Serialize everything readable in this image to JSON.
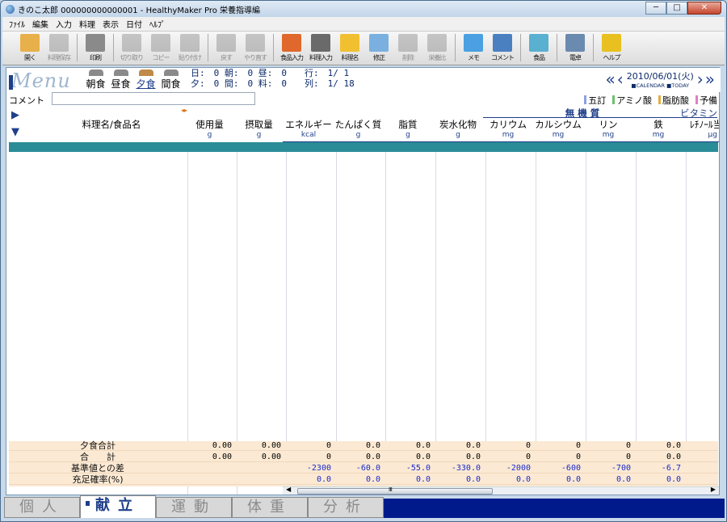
{
  "window": {
    "title": "きのこ太郎 000000000000001 - HealthyMaker Pro 栄養指導編",
    "min": "─",
    "max": "□",
    "close": "✕"
  },
  "menubar": [
    "ﾌｧｲﾙ",
    "編集",
    "入力",
    "料理",
    "表示",
    "日付",
    "ﾍﾙﾌﾟ"
  ],
  "toolbar": [
    {
      "label": "開く",
      "icon": "folder-icon",
      "disabled": false,
      "color": "#e8b04a"
    },
    {
      "label": "料理保存",
      "icon": "save-icon",
      "disabled": true,
      "color": "#8a8a8a"
    },
    {
      "label": "印刷",
      "icon": "printer-icon",
      "disabled": false,
      "color": "#8a8a8a"
    },
    {
      "label": "切り取り",
      "icon": "scissors-icon",
      "disabled": true,
      "color": "#8a8a8a"
    },
    {
      "label": "コピー",
      "icon": "copy-icon",
      "disabled": true,
      "color": "#8a8a8a"
    },
    {
      "label": "貼り付け",
      "icon": "paste-icon",
      "disabled": true,
      "color": "#8a8a8a"
    },
    {
      "label": "戻す",
      "icon": "undo-icon",
      "disabled": true,
      "color": "#8a8a8a"
    },
    {
      "label": "やり直す",
      "icon": "redo-icon",
      "disabled": true,
      "color": "#8a8a8a"
    },
    {
      "label": "食品入力",
      "icon": "vegetable-icon",
      "disabled": false,
      "color": "#e0682c"
    },
    {
      "label": "料理入力",
      "icon": "cutlery-icon",
      "disabled": false,
      "color": "#6a6a6a"
    },
    {
      "label": "料理名",
      "icon": "cook-icon",
      "disabled": false,
      "color": "#f0c030"
    },
    {
      "label": "修正",
      "icon": "eraser-icon",
      "disabled": false,
      "color": "#7ab0e0"
    },
    {
      "label": "削除",
      "icon": "trash-icon",
      "disabled": true,
      "color": "#8a8a8a"
    },
    {
      "label": "栄養比",
      "icon": "scale-icon",
      "disabled": true,
      "color": "#8a8a8a"
    },
    {
      "label": "メモ",
      "icon": "memo-icon",
      "disabled": false,
      "color": "#4aa0e0"
    },
    {
      "label": "コメント",
      "icon": "comment-icon",
      "disabled": false,
      "color": "#4a80c0"
    },
    {
      "label": "食品",
      "icon": "food-icon",
      "disabled": false,
      "color": "#5ab0d0"
    },
    {
      "label": "電卓",
      "icon": "calculator-icon",
      "disabled": false,
      "color": "#6a8ab0"
    },
    {
      "label": "ヘルプ",
      "icon": "help-icon",
      "disabled": false,
      "color": "#e8c020"
    }
  ],
  "header": {
    "logo": "Menu",
    "meals": [
      {
        "label": "朝食",
        "selected": false
      },
      {
        "label": "昼食",
        "selected": false
      },
      {
        "label": "夕食",
        "selected": true
      },
      {
        "label": "間食",
        "selected": false
      }
    ],
    "counts_line1": "日:　0 朝:　0 昼:　0　　行:　1/ 1",
    "counts_line2": "夕:　0 間:　0 料:　0　　列:　1/ 18",
    "date": "2010/06/01(火)",
    "calendar": "CALENDAR",
    "today": "TODAY"
  },
  "comment": {
    "label": "コメント",
    "value": ""
  },
  "tags": [
    {
      "label": "五訂",
      "color": "#8aa0e0"
    },
    {
      "label": "アミノ酸",
      "color": "#70c070"
    },
    {
      "label": "脂肪酸",
      "color": "#e0b040"
    },
    {
      "label": "予備",
      "color": "#e080c0"
    }
  ],
  "columns": {
    "name": "料理名/食品名",
    "group_minerals": "無 機 質",
    "group_vitamins": "ビタミン",
    "cols": [
      {
        "label": "使用量",
        "unit": "g"
      },
      {
        "label": "摂取量",
        "unit": "g"
      },
      {
        "label": "エネルギー",
        "unit": "kcal"
      },
      {
        "label": "たんぱく質",
        "unit": "g"
      },
      {
        "label": "脂質",
        "unit": "g"
      },
      {
        "label": "炭水化物",
        "unit": "g"
      },
      {
        "label": "カリウム",
        "unit": "mg"
      },
      {
        "label": "カルシウム",
        "unit": "mg"
      },
      {
        "label": "リン",
        "unit": "mg"
      },
      {
        "label": "鉄",
        "unit": "mg"
      },
      {
        "label": "ﾚﾁﾉｰﾙ当",
        "unit": "μg"
      }
    ]
  },
  "summary": [
    {
      "label": "夕食合計",
      "values": [
        "0.00",
        "0.00",
        "0",
        "0.0",
        "0.0",
        "0.0",
        "0",
        "0",
        "0",
        "0.0"
      ],
      "neg": false
    },
    {
      "label": "合　　計",
      "values": [
        "0.00",
        "0.00",
        "0",
        "0.0",
        "0.0",
        "0.0",
        "0",
        "0",
        "0",
        "0.0"
      ],
      "neg": false
    },
    {
      "label": "基準値との差",
      "values": [
        "",
        "",
        "-2300",
        "-60.0",
        "-55.0",
        "-330.0",
        "-2000",
        "-600",
        "-700",
        "-6.7"
      ],
      "neg": true
    },
    {
      "label": "充足確率(%)",
      "values": [
        "",
        "",
        "0.0",
        "0.0",
        "0.0",
        "0.0",
        "0.0",
        "0.0",
        "0.0",
        "0.0"
      ],
      "neg": true
    }
  ],
  "tabs": [
    {
      "label": "個人",
      "active": false
    },
    {
      "label": "献立",
      "active": true
    },
    {
      "label": "運動",
      "active": false
    },
    {
      "label": "体重",
      "active": false
    },
    {
      "label": "分析",
      "active": false
    }
  ],
  "scroll_mark": "Ⅲ"
}
